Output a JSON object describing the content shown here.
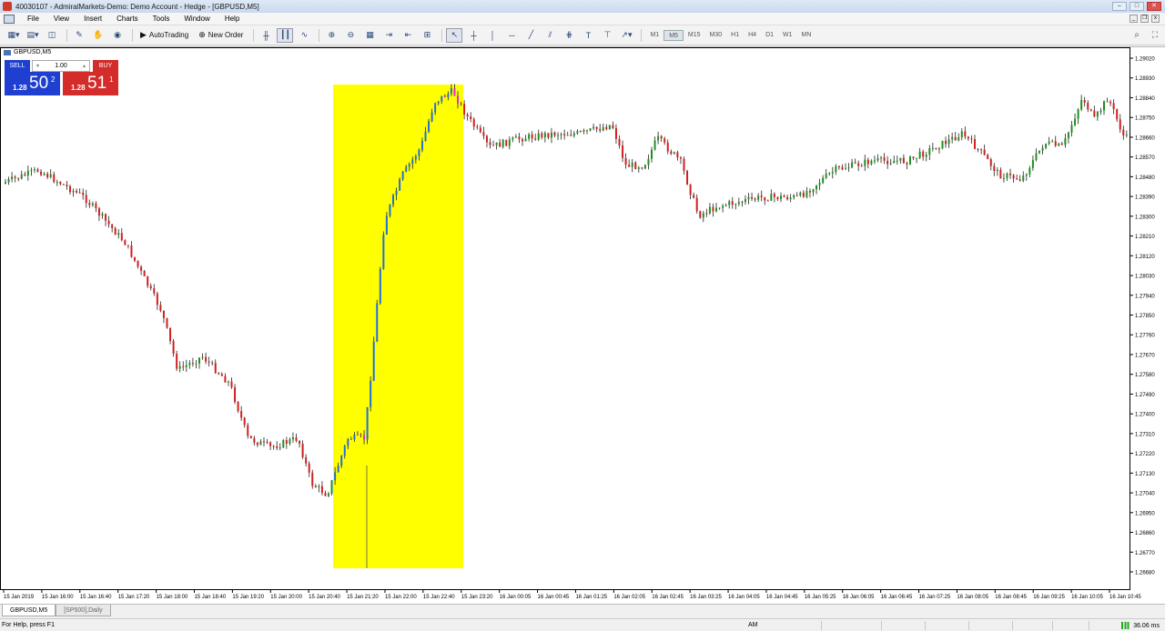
{
  "window": {
    "title": "40030107 - AdmiralMarkets-Demo: Demo Account - Hedge - [GBPUSD,M5]",
    "buttons": {
      "minimize": "–",
      "maximize": "□",
      "close": "✕"
    }
  },
  "menu": {
    "items": [
      "File",
      "View",
      "Insert",
      "Charts",
      "Tools",
      "Window",
      "Help"
    ],
    "mdi": {
      "minimize": "_",
      "restore": "❐",
      "close": "x"
    }
  },
  "toolbar": {
    "autotrading_label": "AutoTrading",
    "new_order_label": "New Order",
    "timeframes": [
      "M1",
      "M5",
      "M15",
      "M30",
      "H1",
      "H4",
      "D1",
      "W1",
      "MN"
    ],
    "active_timeframe": "M5"
  },
  "chart": {
    "symbol_label": "GBPUSD,M5",
    "highlight_color": "#ffff00",
    "bull_color": "#1f8f1f",
    "bear_color": "#d21f1f",
    "price_labels": [
      "1.29020",
      "1.28930",
      "1.28840",
      "1.28750",
      "1.28660",
      "1.28570",
      "1.28480",
      "1.28390",
      "1.28300",
      "1.28210",
      "1.28120",
      "1.28030",
      "1.27940",
      "1.27850",
      "1.27760",
      "1.27670",
      "1.27580",
      "1.27490",
      "1.27400",
      "1.27310",
      "1.27220",
      "1.27130",
      "1.27040",
      "1.26950",
      "1.26860",
      "1.26770",
      "1.26680"
    ],
    "time_labels": [
      "15 Jan 2019",
      "15 Jan 16:00",
      "15 Jan 16:40",
      "15 Jan 17:20",
      "15 Jan 18:00",
      "15 Jan 18:40",
      "15 Jan 19:20",
      "15 Jan 20:00",
      "15 Jan 20:40",
      "15 Jan 21:20",
      "15 Jan 22:00",
      "15 Jan 22:40",
      "15 Jan 23:20",
      "16 Jan 00:05",
      "16 Jan 00:45",
      "16 Jan 01:25",
      "16 Jan 02:05",
      "16 Jan 02:45",
      "16 Jan 03:25",
      "16 Jan 04:05",
      "16 Jan 04:45",
      "16 Jan 05:25",
      "16 Jan 06:05",
      "16 Jan 06:45",
      "16 Jan 07:25",
      "16 Jan 08:05",
      "16 Jan 08:45",
      "16 Jan 09:25",
      "16 Jan 10:05",
      "16 Jan 10:45"
    ]
  },
  "one_click": {
    "sell_label": "SELL",
    "buy_label": "BUY",
    "lot": "1.00",
    "lot_down": "▾",
    "lot_up": "▴",
    "sell_prefix": "1.28",
    "sell_big": "50",
    "sell_sup": "2",
    "buy_prefix": "1.28",
    "buy_big": "51",
    "buy_sup": "1"
  },
  "tabs": [
    "GBPUSD,M5",
    "[SP500],Daily"
  ],
  "status": {
    "help": "For Help, press F1",
    "session": "AM",
    "ping": "36.06 ms"
  }
}
